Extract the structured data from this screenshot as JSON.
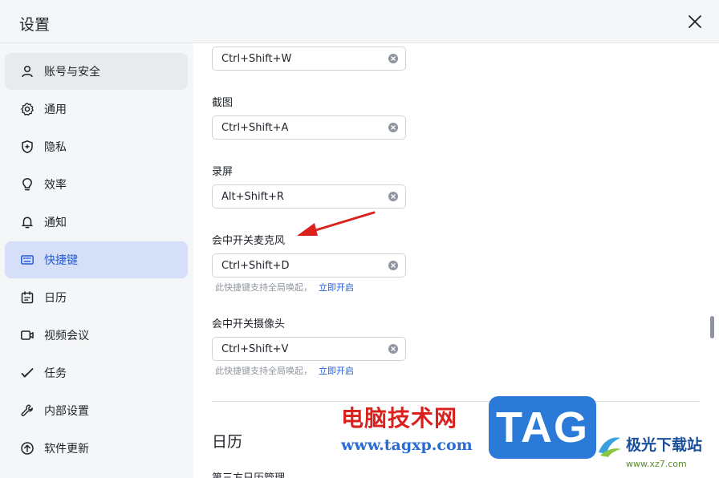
{
  "window": {
    "title": "设置"
  },
  "sidebar": {
    "items": [
      {
        "label": "账号与安全",
        "icon": "user-icon",
        "state": "hover"
      },
      {
        "label": "通用",
        "icon": "gear-icon",
        "state": ""
      },
      {
        "label": "隐私",
        "icon": "shield-icon",
        "state": ""
      },
      {
        "label": "效率",
        "icon": "lightbulb-icon",
        "state": ""
      },
      {
        "label": "通知",
        "icon": "bell-icon",
        "state": ""
      },
      {
        "label": "快捷键",
        "icon": "keyboard-icon",
        "state": "active"
      },
      {
        "label": "日历",
        "icon": "calendar-icon",
        "state": ""
      },
      {
        "label": "视频会议",
        "icon": "video-camera-icon",
        "state": ""
      },
      {
        "label": "任务",
        "icon": "checkmark-icon",
        "state": ""
      },
      {
        "label": "内部设置",
        "icon": "wrench-icon",
        "state": ""
      },
      {
        "label": "软件更新",
        "icon": "upgrade-arrow-icon",
        "state": ""
      }
    ]
  },
  "shortcuts": [
    {
      "label": "",
      "value": "Ctrl+Shift+W",
      "hint": ""
    },
    {
      "label": "截图",
      "value": "Ctrl+Shift+A",
      "hint": ""
    },
    {
      "label": "录屏",
      "value": "Alt+Shift+R",
      "hint": ""
    },
    {
      "label": "会中开关麦克风",
      "value": "Ctrl+Shift+D",
      "hint": "此快捷键支持全局唤起，",
      "hint_link": "立即开启"
    },
    {
      "label": "会中开关摄像头",
      "value": "Ctrl+Shift+V",
      "hint": "此快捷键支持全局唤起，",
      "hint_link": "立即开启"
    }
  ],
  "calendar_section": {
    "title": "日历",
    "subtitle": "第三方日历管理"
  },
  "watermark": {
    "cn_text": "电脑技术网",
    "url": "www.tagxp.com",
    "tag": "TAG",
    "brand": "极光下载站",
    "brand_url": "www.xz7.com"
  },
  "colors": {
    "accent": "#245bdb",
    "active_bg": "#d5e0f8",
    "arrow": "#d9211e"
  }
}
